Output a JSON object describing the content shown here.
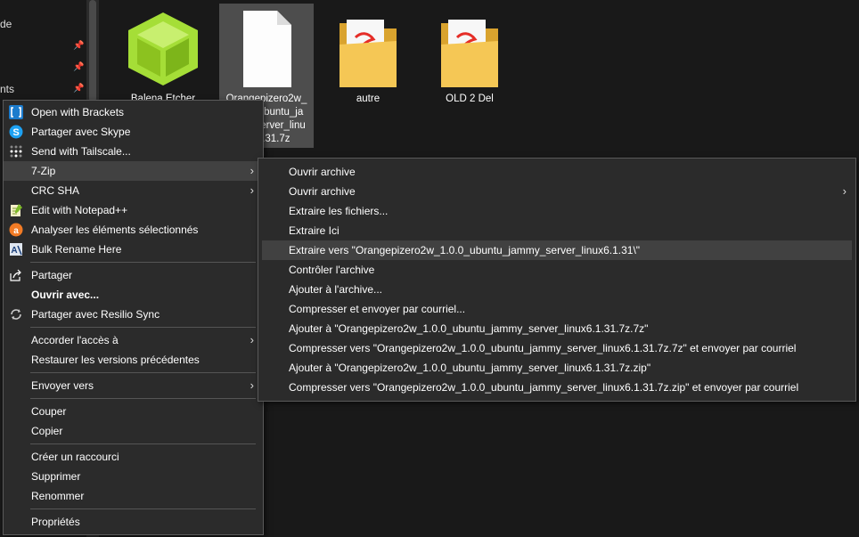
{
  "nav": {
    "items": [
      {
        "label": "de",
        "y": 20
      },
      {
        "label": "nts",
        "y": 93
      }
    ]
  },
  "files": [
    {
      "label": "Balena Etcher Setup",
      "selected": false
    },
    {
      "label": "Orangepizero2w_1.0.0_ubuntu_jammy_server_linux6.1.31.7z",
      "label_lines": [
        "Orangepizero2w_",
        "1.0.0_ubuntu_ja",
        "mmy_server_linu",
        "x6.1.31.7z"
      ],
      "selected": true
    },
    {
      "label": "autre",
      "selected": false
    },
    {
      "label": "OLD 2 Del",
      "selected": false
    }
  ],
  "context_menu": {
    "items": [
      {
        "label": "Open with Brackets",
        "icon": "brackets-icon"
      },
      {
        "label": "Partager avec Skype",
        "icon": "skype-icon"
      },
      {
        "label": "Send with Tailscale...",
        "icon": "tailscale-icon"
      },
      {
        "label": "7-Zip",
        "submenu": true
      },
      {
        "label": "CRC SHA",
        "submenu": true
      },
      {
        "label": "Edit with Notepad++",
        "icon": "notepadpp-icon"
      },
      {
        "label": "Analyser les éléments sélectionnés",
        "icon": "avast-icon"
      },
      {
        "label": "Bulk Rename Here",
        "icon": "bulk-rename-icon"
      },
      {
        "label": "Partager",
        "icon": "share-icon"
      },
      {
        "label": "Ouvrir avec...",
        "bold": true
      },
      {
        "label": "Partager avec Resilio Sync",
        "icon": "resilio-icon"
      },
      {
        "label": "Accorder l'accès à",
        "submenu": true
      },
      {
        "label": "Restaurer les versions précédentes"
      },
      {
        "label": "Envoyer vers",
        "submenu": true
      },
      {
        "label": "Couper"
      },
      {
        "label": "Copier"
      },
      {
        "label": "Créer un raccourci"
      },
      {
        "label": "Supprimer"
      },
      {
        "label": "Renommer"
      },
      {
        "label": "Propriétés"
      }
    ]
  },
  "submenu_7zip": {
    "items": [
      {
        "label": "Ouvrir archive"
      },
      {
        "label": "Ouvrir archive",
        "submenu": true
      },
      {
        "label": "Extraire les fichiers..."
      },
      {
        "label": "Extraire Ici"
      },
      {
        "label": "Extraire vers \"Orangepizero2w_1.0.0_ubuntu_jammy_server_linux6.1.31\\\""
      },
      {
        "label": "Contrôler l'archive"
      },
      {
        "label": "Ajouter à l'archive..."
      },
      {
        "label": "Compresser et envoyer par courriel..."
      },
      {
        "label": "Ajouter à \"Orangepizero2w_1.0.0_ubuntu_jammy_server_linux6.1.31.7z.7z\""
      },
      {
        "label": "Compresser vers \"Orangepizero2w_1.0.0_ubuntu_jammy_server_linux6.1.31.7z.7z\" et envoyer par courriel"
      },
      {
        "label": "Ajouter à \"Orangepizero2w_1.0.0_ubuntu_jammy_server_linux6.1.31.7z.zip\""
      },
      {
        "label": "Compresser vers \"Orangepizero2w_1.0.0_ubuntu_jammy_server_linux6.1.31.7z.zip\" et envoyer par courriel"
      }
    ]
  },
  "colors": {
    "menu_bg": "#2b2b2b",
    "hover": "#414141",
    "selected_file": "#4d4d4d",
    "folder": "#f5c755",
    "pdf": "#e52d27",
    "etcher": "#a5de37"
  }
}
